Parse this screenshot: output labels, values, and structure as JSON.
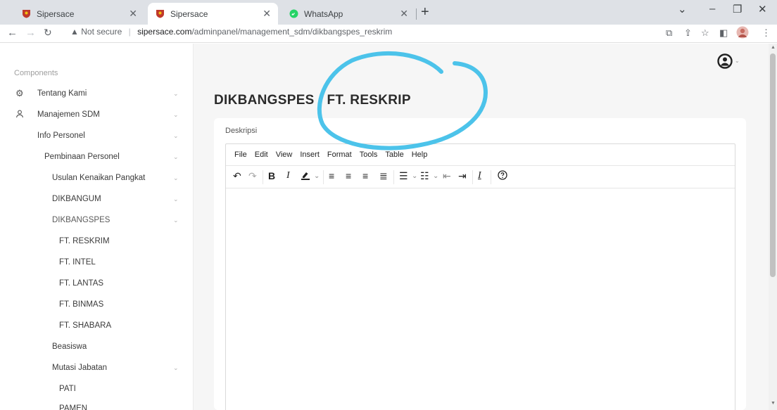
{
  "browser": {
    "tabs": [
      {
        "title": "Sipersace",
        "active": false
      },
      {
        "title": "Sipersace",
        "active": true
      },
      {
        "title": "WhatsApp",
        "active": false
      }
    ],
    "new_tab_label": "+",
    "url": {
      "security": "Not secure",
      "host": "sipersace.com",
      "path": "/adminpanel/management_sdm/dikbangspes_reskrim"
    }
  },
  "sidebar": {
    "heading": "Components",
    "items": [
      {
        "label": "Tentang Kami",
        "icon": "gear-icon",
        "has_chevron": true
      },
      {
        "label": "Manajemen SDM",
        "icon": "user-icon",
        "has_chevron": true
      },
      {
        "label": "Info Personel",
        "has_chevron": true
      },
      {
        "label": "Pembinaan Personel",
        "has_chevron": true
      },
      {
        "label": "Usulan Kenaikan Pangkat",
        "has_chevron": true
      },
      {
        "label": "DIKBANGUM",
        "has_chevron": true
      },
      {
        "label": "DIKBANGSPES",
        "has_chevron": true
      },
      {
        "label": "FT. RESKRIM",
        "has_chevron": false
      },
      {
        "label": "FT. INTEL",
        "has_chevron": false
      },
      {
        "label": "FT. LANTAS",
        "has_chevron": false
      },
      {
        "label": "FT. BINMAS",
        "has_chevron": false
      },
      {
        "label": "FT. SHABARA",
        "has_chevron": false
      },
      {
        "label": "Beasiswa",
        "has_chevron": false
      },
      {
        "label": "Mutasi Jabatan",
        "has_chevron": true
      },
      {
        "label": "PATI",
        "has_chevron": false
      },
      {
        "label": "PAMEN",
        "has_chevron": false
      }
    ]
  },
  "main": {
    "title": "DIKBANGSPES - FT. RESKRIP",
    "field_label": "Deskripsi",
    "editor_menu": [
      "File",
      "Edit",
      "View",
      "Insert",
      "Format",
      "Tools",
      "Table",
      "Help"
    ],
    "editor_content": ""
  },
  "colors": {
    "annotation": "#4cc3ea",
    "sidebar_bg": "#ffffff",
    "page_bg": "#f6f6f6"
  }
}
